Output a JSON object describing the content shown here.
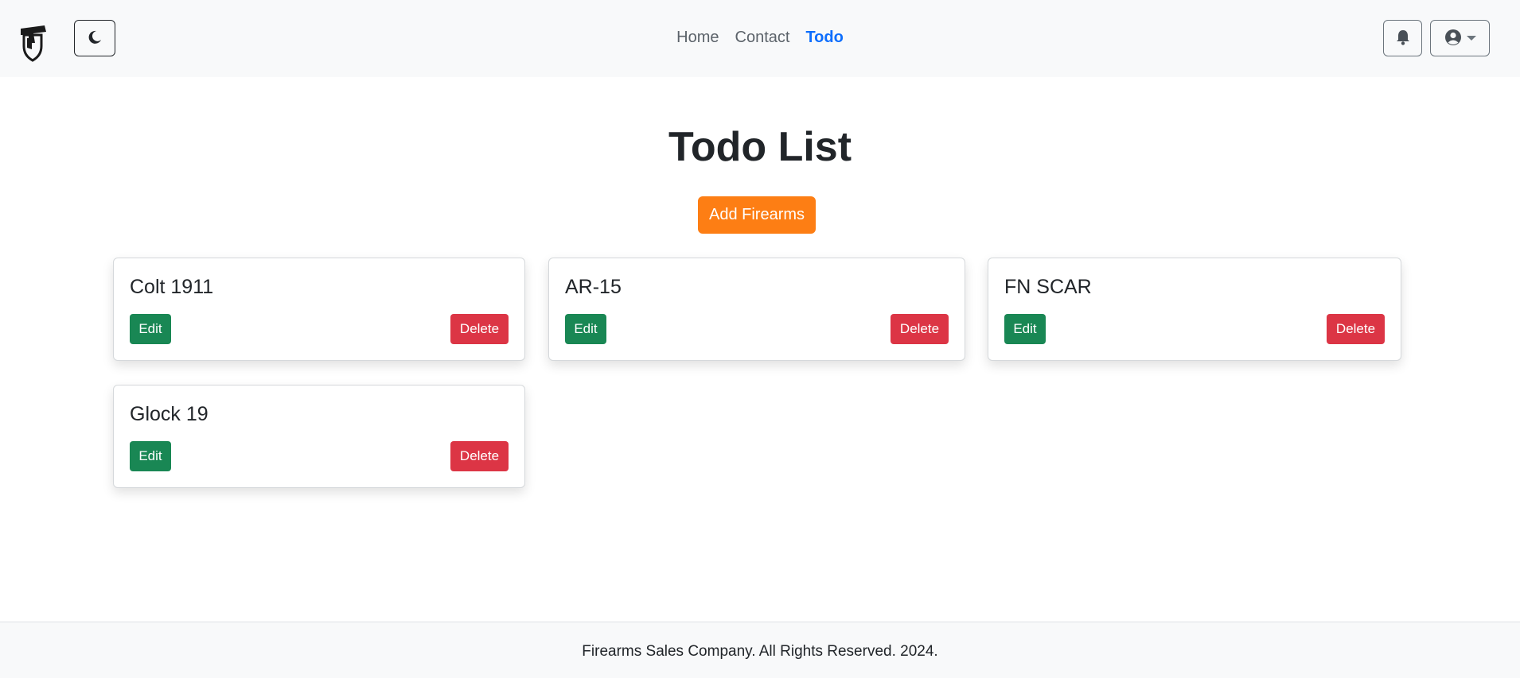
{
  "navbar": {
    "brand_icon": "pistol-shield-logo",
    "theme_toggle_icon": "moon-icon",
    "links": [
      {
        "label": "Home"
      },
      {
        "label": "Contact"
      },
      {
        "label": "Todo"
      }
    ],
    "active_link": "Todo",
    "notification_icon": "bell-icon",
    "user_icon": "user-circle-icon"
  },
  "main": {
    "title": "Todo List",
    "add_button_label": "Add Firearms",
    "cards": [
      {
        "title": "Colt 1911",
        "edit_label": "Edit",
        "delete_label": "Delete"
      },
      {
        "title": "AR-15",
        "edit_label": "Edit",
        "delete_label": "Delete"
      },
      {
        "title": "FN SCAR",
        "edit_label": "Edit",
        "delete_label": "Delete"
      },
      {
        "title": "Glock 19",
        "edit_label": "Edit",
        "delete_label": "Delete"
      }
    ]
  },
  "footer": {
    "text": "Firearms Sales Company. All Rights Reserved. 2024."
  },
  "colors": {
    "primary": "#0d6efd",
    "accent_orange": "#fd7e14",
    "success": "#198754",
    "danger": "#dc3545",
    "navbar_bg": "#f8f9fa"
  }
}
